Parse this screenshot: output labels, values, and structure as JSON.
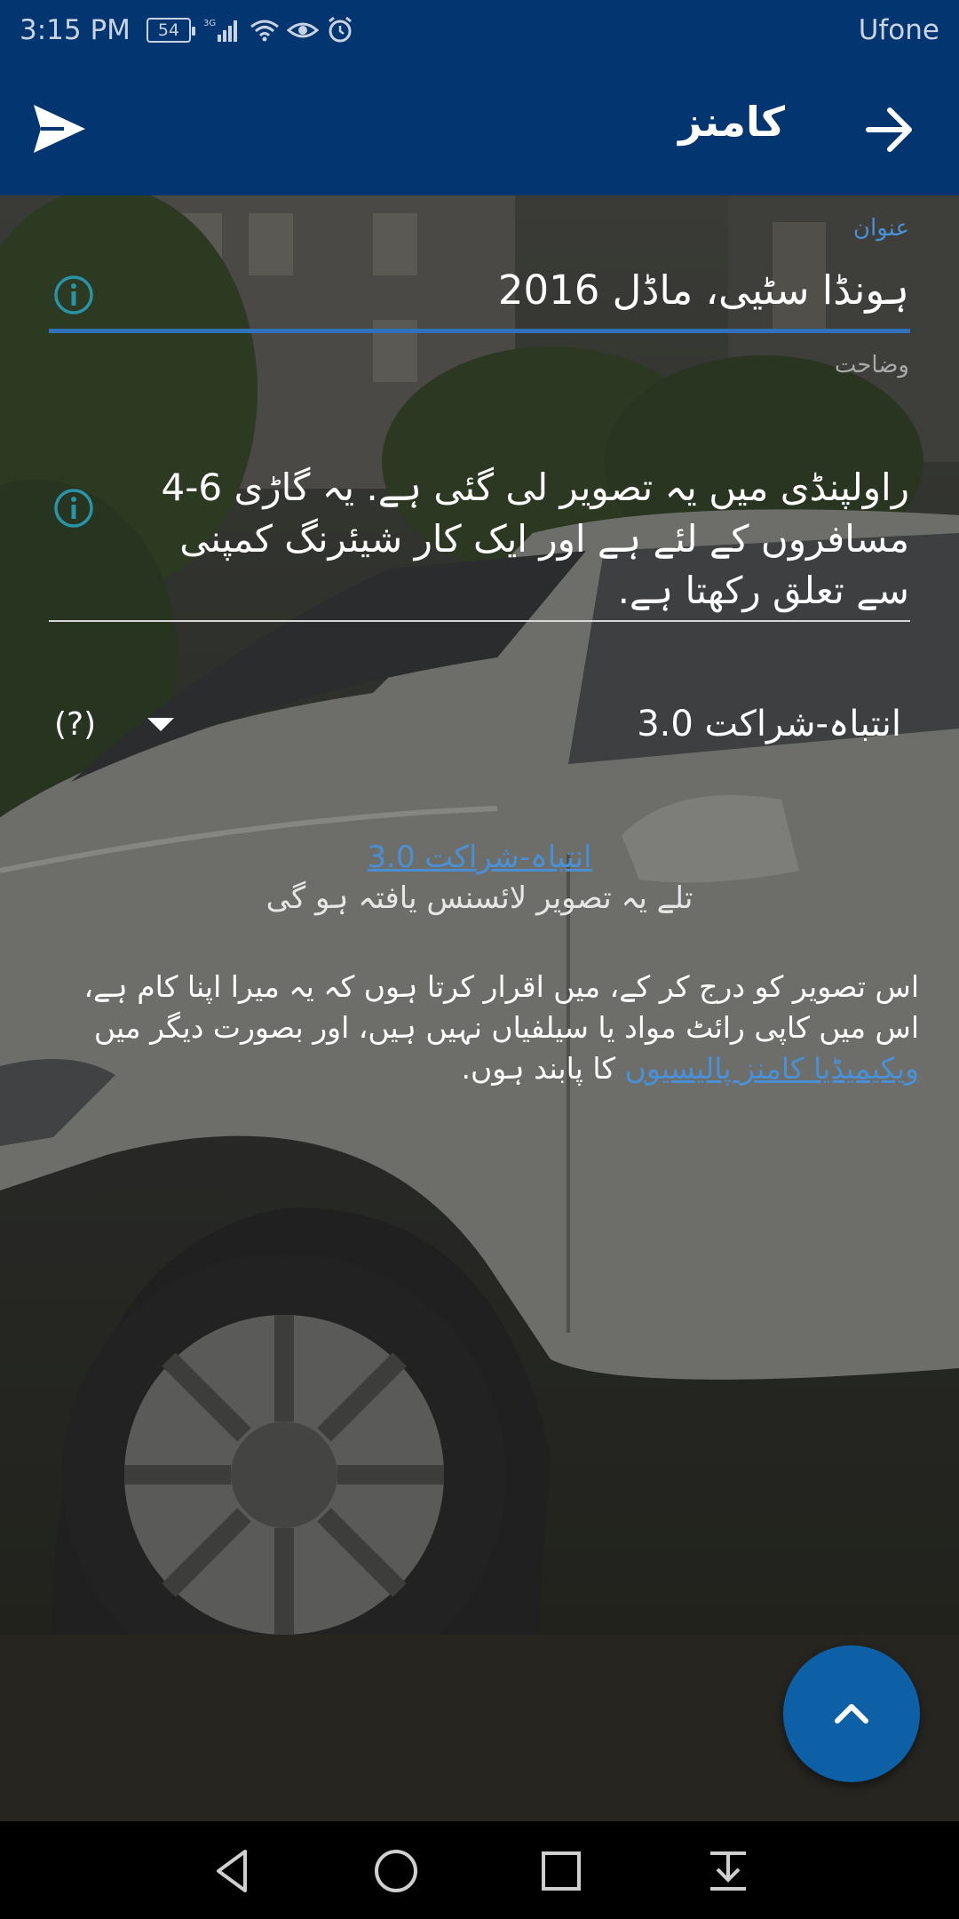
{
  "status_bar": {
    "time": "3:15 PM",
    "battery": "54",
    "network": "3G",
    "carrier": "Ufone"
  },
  "toolbar": {
    "title": "کامنز",
    "send_icon": "send-icon",
    "back_icon": "arrow-forward-icon"
  },
  "form": {
    "title_label": "عنوان",
    "title_value": "ہونڈا سٹیی، ماڈل 2016",
    "description_label": "وضاحت",
    "description_value": "راولپنڈی میں یہ تصویر لی گئی ہے. یہ گاڑی 6-4 مسافروں کے لئے ہے اور ایک کار شیئرنگ کمپنی سے تعلق رکھتا ہے.",
    "license_selected": "انتباہ-شراکت 3.0",
    "license_help": "(?)"
  },
  "license_note": {
    "link": "انتباہ-شراکت 3.0",
    "text": "تلے یہ تصویر لائسنس یافتہ ہو گی"
  },
  "declaration": {
    "text_before": "اس تصویر کو درج کر کے، میں اقرار کرتا ہوں کہ یہ میرا اپنا کام ہے، اس میں کاپی رائٹ مواد یا سیلفیاں نہیں ہیں، اور بصورت دیگر میں ",
    "link": "ویکیمیڈیا کامنز پالیسیوں",
    "text_after": " کا پابند ہوں."
  },
  "colors": {
    "primary": "#033570",
    "accent": "#4a90d6",
    "fab": "#0d5fa6"
  }
}
